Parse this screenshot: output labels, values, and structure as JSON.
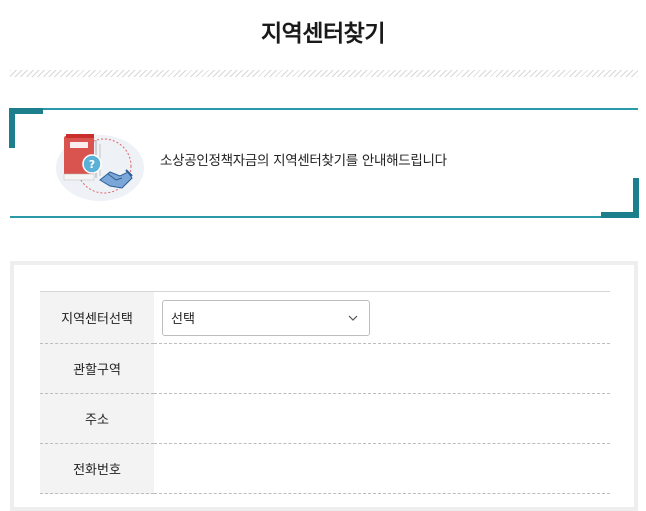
{
  "header": {
    "title": "지역센터찾기"
  },
  "notice": {
    "message": "소상공인정책자금의 지역센터찾기를 안내해드립니다",
    "illustration": "book-question-handshake-icon",
    "accent_color": "#2a9aa8"
  },
  "form": {
    "rows": [
      {
        "label": "지역센터선택",
        "type": "select",
        "value": "선택"
      },
      {
        "label": "관할구역",
        "type": "text",
        "value": ""
      },
      {
        "label": "주소",
        "type": "text",
        "value": ""
      },
      {
        "label": "전화번호",
        "type": "text",
        "value": ""
      }
    ],
    "select_icon": "chevron-down-icon"
  }
}
